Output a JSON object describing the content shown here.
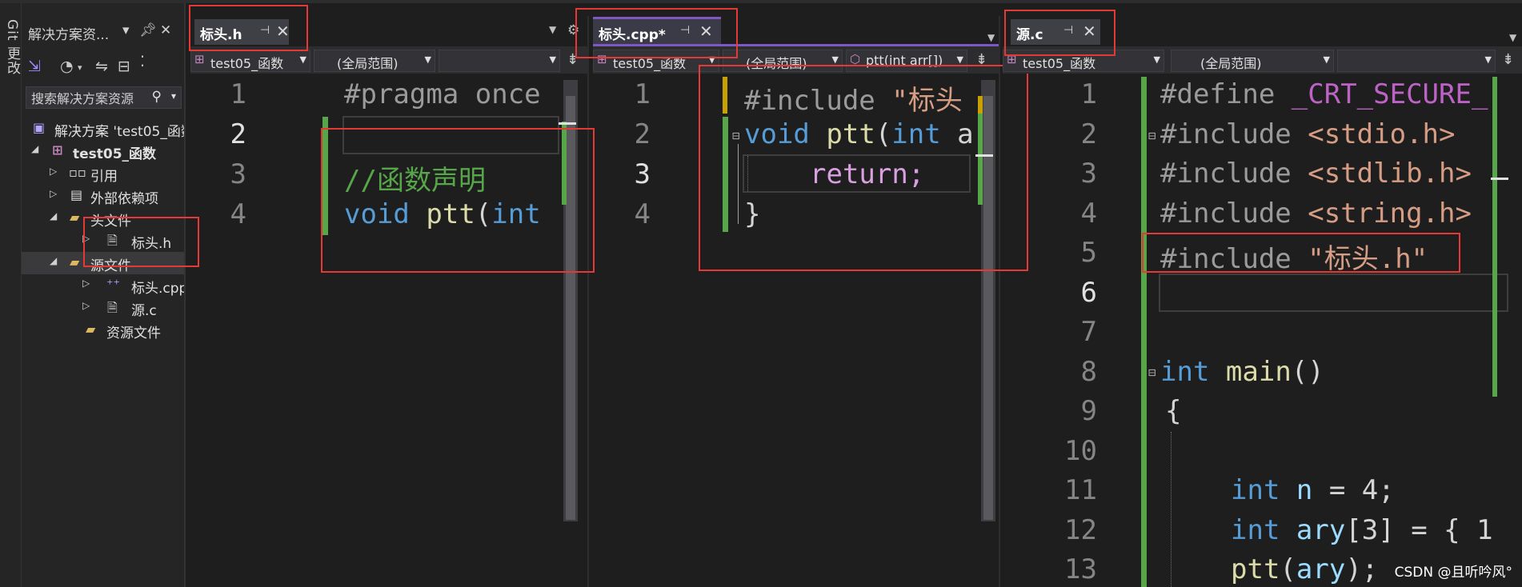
{
  "git_panel": {
    "label": "Git 更改"
  },
  "solution_explorer": {
    "title": "解决方案资...",
    "search_placeholder": "搜索解决方案资源",
    "tree": [
      {
        "label": "解决方案 'test05_函数'",
        "icon": "solution-icon"
      },
      {
        "label": "test05_函数",
        "icon": "cpp-project-icon",
        "bold": true
      },
      {
        "label": "引用",
        "icon": "references-icon"
      },
      {
        "label": "外部依赖项",
        "icon": "external-deps-icon"
      },
      {
        "label": "头文件",
        "icon": "folder-filter-icon"
      },
      {
        "label": "标头.h",
        "icon": "header-file-icon"
      },
      {
        "label": "源文件",
        "icon": "folder-filter-icon",
        "selected": true
      },
      {
        "label": "标头.cpp",
        "icon": "cpp-file-icon"
      },
      {
        "label": "源.c",
        "icon": "c-file-icon"
      },
      {
        "label": "资源文件",
        "icon": "folder-filter-icon"
      }
    ]
  },
  "panes": {
    "header": {
      "tab": "标头.h",
      "nav": {
        "project": "test05_函数",
        "scope": "(全局范围)",
        "member": ""
      },
      "lines": {
        "n1": "1",
        "n2": "2",
        "n3": "3",
        "n4": "4",
        "l1": "#pragma once",
        "l3": "//函数声明",
        "l4_kw": "void",
        "l4_fn": "ptt",
        "l4_rest": "(",
        "l4_kw2": "int"
      }
    },
    "cpp": {
      "tab": "标头.cpp*",
      "nav": {
        "project": "test05_函数",
        "scope": "(全局范围)",
        "member": "ptt(int arr[])"
      },
      "lines": {
        "n1": "1",
        "n2": "2",
        "n3": "3",
        "n4": "4",
        "l1_pp": "#include",
        "l1_str": "\"标头",
        "l2_kw": "void",
        "l2_fn": "ptt",
        "l2_p": "(",
        "l2_kw2": "int",
        "l2_rest": " a",
        "l3": "return;",
        "l4": "}"
      }
    },
    "source": {
      "tab": "源.c",
      "nav": {
        "project": "test05_函数",
        "scope": "(全局范围)",
        "member": ""
      },
      "lines": {
        "n1": "1",
        "n2": "2",
        "n3": "3",
        "n4": "4",
        "n5": "5",
        "n6": "6",
        "n7": "7",
        "n8": "8",
        "n9": "9",
        "n10": "10",
        "n11": "11",
        "n12": "12",
        "n13": "13",
        "l1_pp": "#define",
        "l1_macro": "_CRT_SECURE_",
        "l2_pp": "#include",
        "l2_str": "<stdio.h>",
        "l3_pp": "#include",
        "l3_str": "<stdlib.h>",
        "l4_pp": "#include",
        "l4_str": "<string.h>",
        "l5_pp": "#include",
        "l5_str": "\"标头.h\"",
        "l8_kw": "int",
        "l8_fn": "main",
        "l8_p": "()",
        "l9": "{",
        "l11_kw": "int",
        "l11_var": "n",
        "l11_rest": " = 4;",
        "l12_kw": "int",
        "l12_var": "ary",
        "l12_rest": "[3] = { 1",
        "l13_fn": "ptt",
        "l13_p": "(",
        "l13_var": "ary",
        "l13_rest": ");"
      }
    }
  },
  "watermark": "CSDN @且听吟风°",
  "colors": {
    "background": "#1e1e1e",
    "highlight": "#e53935",
    "change_bar": "#57a64a",
    "active_tab_accent": "#7e57c2"
  }
}
